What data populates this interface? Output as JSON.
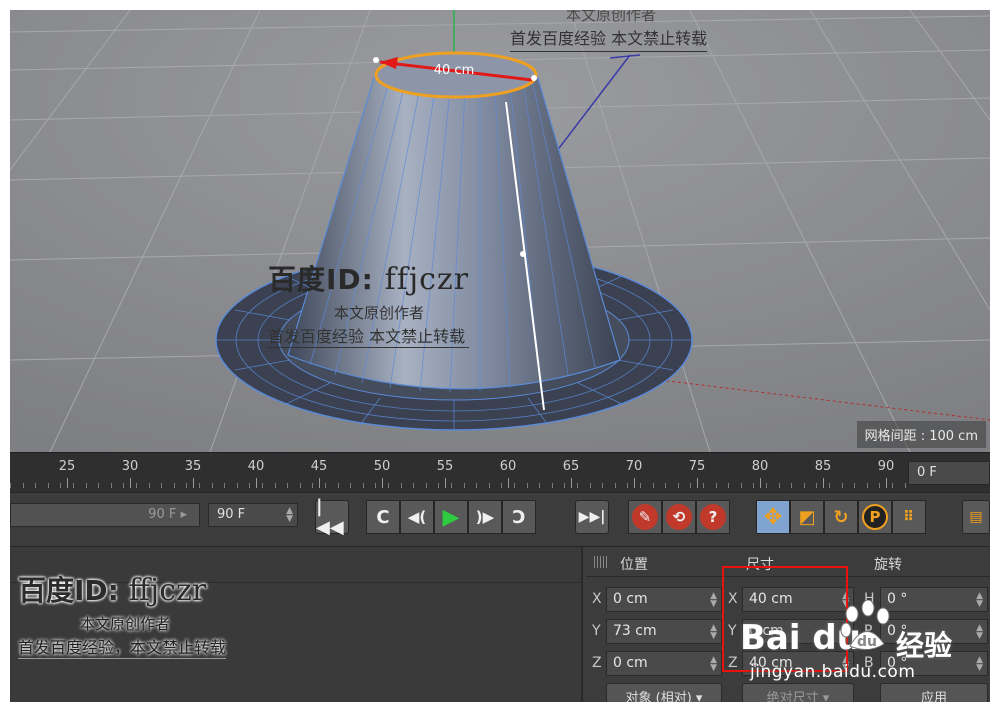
{
  "viewport": {
    "dimension_label": "40 cm",
    "grid_spacing": "网格间距 : 100 cm"
  },
  "watermark": {
    "author_line": "本文原创作者",
    "notice_line": "首发百度经验 本文禁止转载",
    "notice_line_bottom": "首发百度经验，本文禁止转载",
    "id_prefix": "百度ID:",
    "id_name": "ffjczr"
  },
  "timeline": {
    "ticks": [
      "25",
      "30",
      "35",
      "40",
      "45",
      "50",
      "55",
      "60",
      "65",
      "70",
      "75",
      "80",
      "85",
      "90"
    ],
    "current_frame": "0 F"
  },
  "transport": {
    "slider_value": "90 F",
    "end_frame": "90 F",
    "buttons": [
      "goto-start",
      "prev-key",
      "prev-frame",
      "play",
      "next-frame",
      "next-key",
      "goto-end",
      "record",
      "autokey",
      "help",
      "move",
      "scale",
      "rotate",
      "param",
      "points"
    ]
  },
  "coordinates": {
    "headers": {
      "position": "位置",
      "size": "尺寸",
      "rotation": "旋转"
    },
    "position": {
      "x": "0 cm",
      "y": "73 cm",
      "z": "0 cm"
    },
    "size": {
      "x": "40 cm",
      "y": "0 cm",
      "z": "40 cm"
    },
    "rotation": {
      "h": "0 °",
      "p": "0 °",
      "b": "0 °"
    },
    "axis_labels": {
      "x": "X",
      "y": "Y",
      "z": "Z",
      "h": "H",
      "p": "P",
      "b": "B"
    },
    "mode_dropdown": "对象 (相对)",
    "size_mode_dropdown": "绝对尺寸",
    "apply_label": "应用"
  },
  "brand": {
    "logo_text": "Bai du",
    "jingyan": "经验",
    "url": "jingyan.baidu.com"
  },
  "colors": {
    "highlight": "#e8140c",
    "selection_ring": "#f0a020",
    "active_tool": "#7ea4cf",
    "record_red": "#c0392b"
  }
}
